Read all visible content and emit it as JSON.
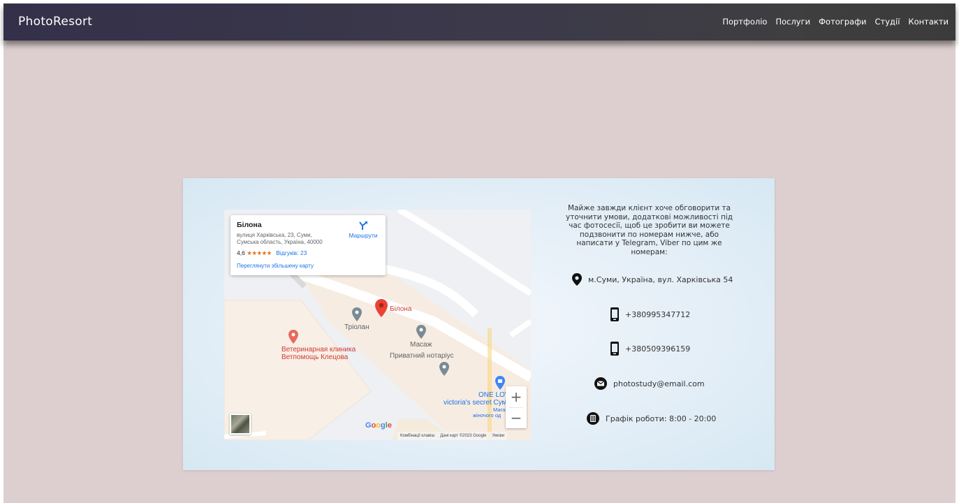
{
  "header": {
    "brand": "PhotoResort",
    "nav": [
      {
        "label": "Портфоліо"
      },
      {
        "label": "Послуги"
      },
      {
        "label": "Фотографи"
      },
      {
        "label": "Студії"
      },
      {
        "label": "Контакти"
      }
    ]
  },
  "map": {
    "place": {
      "name": "Білона",
      "address": "вулиця Харківська, 23, Суми, Сумська область, Україна, 40000",
      "rating": "4,6",
      "stars": "★★★★★",
      "reviews": "Відгуків: 23",
      "directions": "Маршрути",
      "view_larger": "Переглянути збільшену карту"
    },
    "labels": {
      "bilona": "Білона",
      "triolan": "Тріолан",
      "vet_line1": "Ветеринарная клиника",
      "vet_line2": "Ветпомощь Клецова",
      "massage": "Масаж",
      "notary": "Приватний нотаріус",
      "one_love": "ONE LOV",
      "victoria": "victoria's secret Сум",
      "shop_line1": "Магаз",
      "shop_line2": "жіночого од"
    },
    "google": "Google",
    "footer": {
      "shortcuts": "Комбінації клавіш",
      "data": "Дані карт ©2023 Google",
      "terms": "Умови"
    },
    "zoom_in": "+",
    "zoom_out": "−"
  },
  "contact": {
    "intro": "Майже завжди клієнт хоче обговорити та уточнити умови, додаткові можливості під час фотосесії, щоб це зробити ви можете подзвонити по номерам нижче, або написати у Telegram, Viber по цим же номерам:",
    "address": "м.Суми, Україна, вул. Харківська 54",
    "phone1": "+380995347712",
    "phone2": "+380509396159",
    "email": "photostudy@email.com",
    "hours": "Графік роботи: 8:00 - 20:00"
  },
  "colors": {
    "nav_bg": "#3a374a",
    "page_bg": "#ddcfcf",
    "card_bg": "#e3eef7",
    "pin_red": "#ea4335",
    "link_blue": "#1a73e8"
  }
}
